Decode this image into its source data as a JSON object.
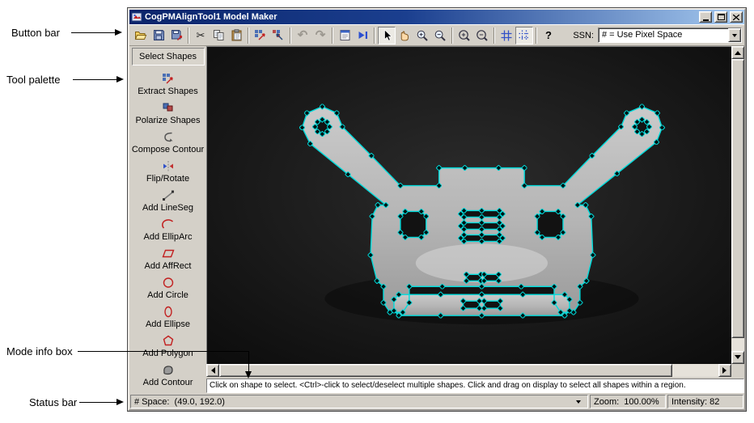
{
  "annotations": {
    "button_bar": "Button bar",
    "tool_palette": "Tool palette",
    "mode_info_box": "Mode info box",
    "status_bar": "Status bar"
  },
  "window": {
    "title": "CogPMAlignTool1 Model Maker"
  },
  "toolbar": {
    "ssn_label": "SSN:",
    "ssn_value": "# = Use Pixel Space",
    "glyphs": {
      "cut": "✂",
      "undo": "↶",
      "redo": "↷",
      "help": "?"
    }
  },
  "palette": {
    "items": [
      {
        "label": "Select Shapes",
        "selected": true
      },
      {
        "label": "Extract Shapes"
      },
      {
        "label": "Polarize Shapes"
      },
      {
        "label": "Compose Contour"
      },
      {
        "label": "Flip/Rotate"
      },
      {
        "label": "Add LineSeg"
      },
      {
        "label": "Add EllipArc"
      },
      {
        "label": "Add AffRect"
      },
      {
        "label": "Add Circle"
      },
      {
        "label": "Add Ellipse"
      },
      {
        "label": "Add Polygon"
      },
      {
        "label": "Add Contour"
      }
    ]
  },
  "mode_info": {
    "text": "Click on shape to select. <Ctrl>-click to select/deselect multiple shapes. Click and drag on display to select all shapes within a region."
  },
  "status": {
    "space": "# Space:  (49.0, 192.0)",
    "zoom": "Zoom:  100.00%",
    "intensity": "Intensity: 82"
  },
  "colors": {
    "contour": "#00dcdc",
    "chrome": "#d4d0c8",
    "title_gradient_left": "#0a246a",
    "title_gradient_right": "#a6caf0",
    "display_bg": "#141414"
  }
}
